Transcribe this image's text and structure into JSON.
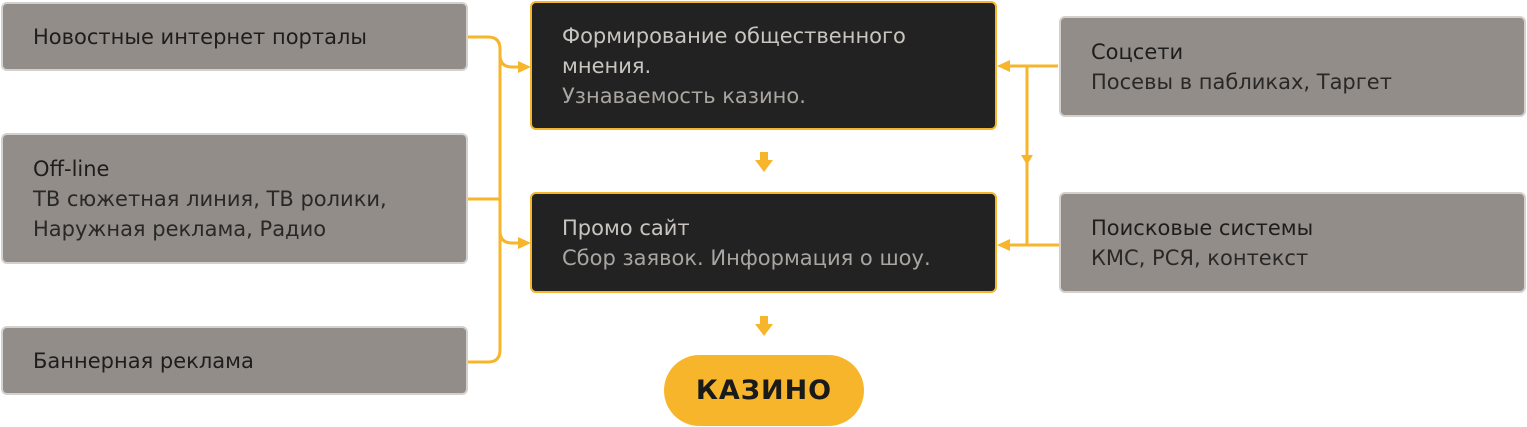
{
  "colors": {
    "accent": "#f6b52a",
    "gray_box": "#928d89",
    "dark_box": "#222222"
  },
  "left": {
    "news": {
      "title": "Новостные интернет порталы"
    },
    "offline": {
      "title": "Off-line",
      "lines": [
        "ТВ сюжетная линия, ТВ ролики,",
        "Наружная реклама, Радио"
      ]
    },
    "banner": {
      "title": "Баннерная реклама"
    }
  },
  "center": {
    "opinion": {
      "title_lines": [
        "Формирование общественного",
        "мнения."
      ],
      "subtitle": "Узнаваемость казино."
    },
    "promo": {
      "title": "Промо сайт",
      "subtitle": "Сбор заявок. Информация о шоу."
    },
    "casino": {
      "label": "КАЗИНО"
    }
  },
  "right": {
    "social": {
      "title": "Соцсети",
      "subtitle": "Посевы в пабликах, Таргет"
    },
    "search": {
      "title": "Поисковые системы",
      "subtitle": "КМС, РСЯ, контекст"
    }
  }
}
